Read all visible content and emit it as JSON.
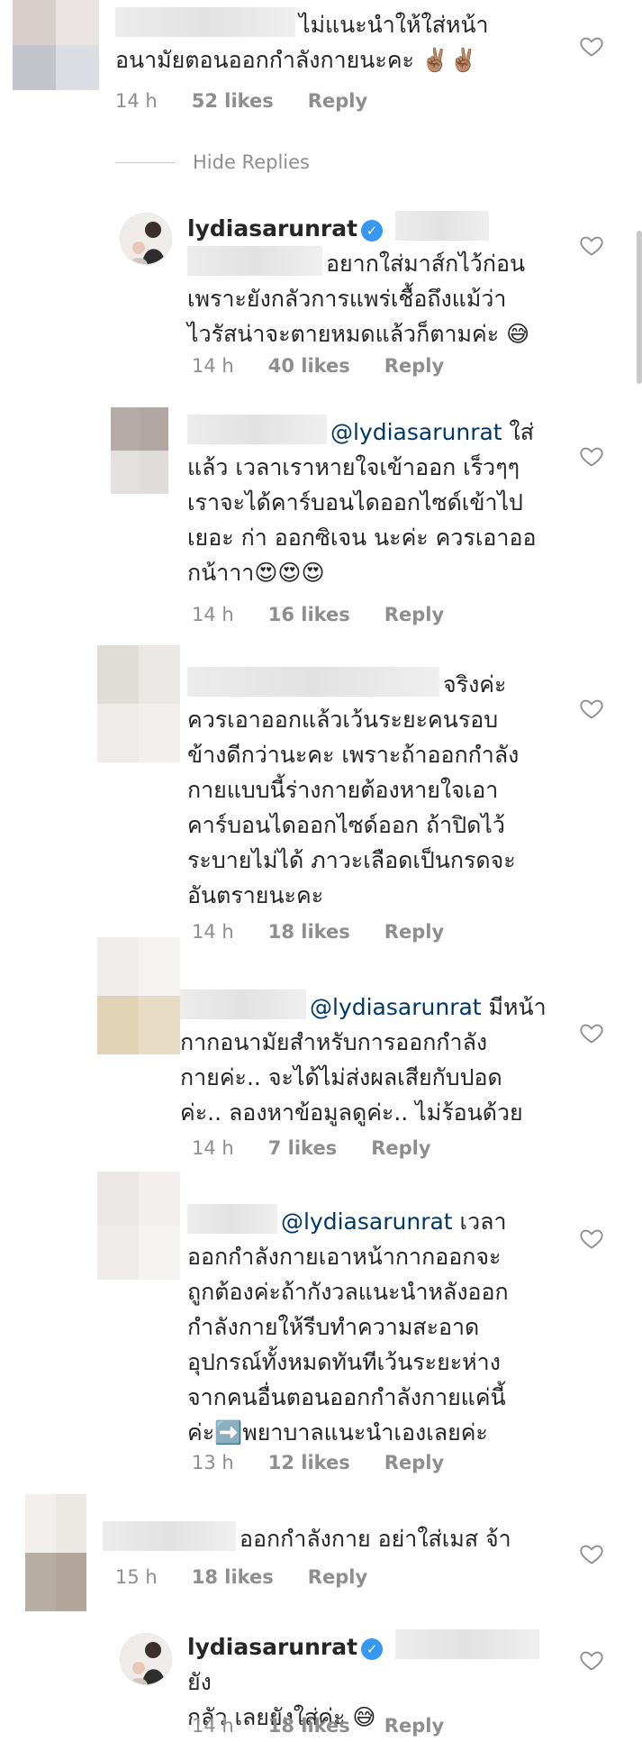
{
  "hide_replies_label": "Hide Replies",
  "comments": [
    {
      "line1": "ไม่แนะนำให้ใส่หน้า",
      "line2": "อนามัยตอนออกกำลังกายนะคะ ✌🏽✌🏽",
      "time": "14 h",
      "likes": "52 likes",
      "reply": "Reply"
    },
    {
      "username": "lydiasarunrat",
      "line1": "อยากใส่มาส์กไว้ก่อน",
      "line2": "เพราะยังกลัวการแพร่เชื้อถึงแม้ว่า",
      "line3": "ไวรัสน่าจะตายหมดแล้วก็ตามค่ะ 😅",
      "time": "14 h",
      "likes": "40 likes",
      "reply": "Reply"
    },
    {
      "mention": "@lydiasarunrat",
      "line1_rest": " ใส่",
      "line2": "แล้ว เวลาเราหายใจเข้าออก เร็วๆๆ",
      "line3": "เราจะได้คาร์บอนไดออกไซด์เข้าไป",
      "line4": "เยอะ ก่า ออกซิเจน นะค่ะ ควรเอาออ",
      "line5": "กน้าาา😍😍😍",
      "time": "14 h",
      "likes": "16 likes",
      "reply": "Reply"
    },
    {
      "line1": "จริงค่ะ",
      "line2": "ควรเอาออกแล้วเว้นระยะคนรอบ",
      "line3": "ข้างดีกว่านะคะ เพราะถ้าออกกำลัง",
      "line4": "กายแบบนี้ร่างกายต้องหายใจเอา",
      "line5": "คาร์บอนไดออกไซด์ออก ถ้าปิดไว้",
      "line6": "ระบายไม่ได้ ภาวะเลือดเป็นกรดจะ",
      "line7": "อันตรายนะคะ",
      "time": "14 h",
      "likes": "18 likes",
      "reply": "Reply"
    },
    {
      "mention": "@lydiasarunrat",
      "line1_rest": " มีหน้า",
      "line2": "กากอนามัยสำหรับการออกกำลัง",
      "line3": "กายค่ะ.. จะได้ไม่ส่งผลเสียกับปอด",
      "line4": "ค่ะ.. ลองหาข้อมูลดูค่ะ.. ไม่ร้อนด้วย",
      "time": "14 h",
      "likes": "7 likes",
      "reply": "Reply"
    },
    {
      "mention": "@lydiasarunrat",
      "line1_rest": " เวลา",
      "line2": "ออกกำลังกายเอาหน้ากากออกจะ",
      "line3": "ถูกต้องค่ะถ้ากังวลแนะนำหลังออก",
      "line4": "กำลังกายให้รีบทำความสะอาด",
      "line5": "อุปกรณ์ทั้งหมดทันทีเว้นระยะห่าง",
      "line6": "จากคนอื่นตอนออกกำลังกายแค่นี้",
      "line7": "ค่ะ➡️พยาบาลแนะนำเองเลยค่ะ",
      "time": "13 h",
      "likes": "12 likes",
      "reply": "Reply"
    },
    {
      "line1": "ออกกำลังกาย อย่าใส่เมส จ้า",
      "time": "15 h",
      "likes": "18 likes",
      "reply": "Reply"
    },
    {
      "username": "lydiasarunrat",
      "line1_rest": "ยัง",
      "line2": "กลัว เลยยังใส่ค่ะ 😅",
      "time": "14 h",
      "likes": "18 likes",
      "reply": "Reply"
    }
  ],
  "icons": {
    "like": "heart-icon",
    "verified": "verified-badge-icon"
  },
  "colors": {
    "text": "#262626",
    "meta": "#8e8e8e",
    "mention": "#00376b",
    "verified": "#3897f0"
  }
}
